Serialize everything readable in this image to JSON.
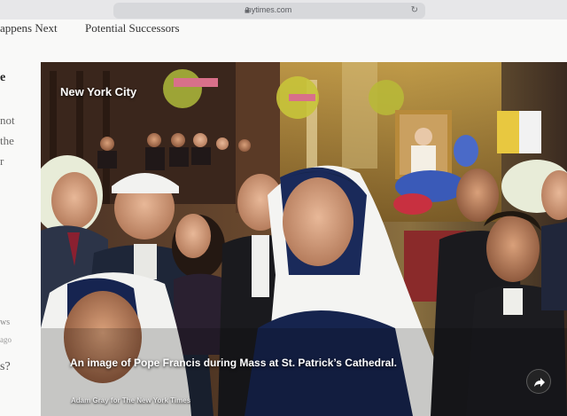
{
  "browser": {
    "url": "nytimes.com",
    "lock_icon": "lock-icon",
    "reload_icon": "reload-icon"
  },
  "topnav": {
    "items": [
      "appens Next",
      "Potential Successors"
    ]
  },
  "sidebar": {
    "fragments": [
      "e",
      "not",
      "the",
      "r",
      "ws",
      "ago",
      "s?"
    ]
  },
  "hero": {
    "location": "New York City",
    "caption": "An image of Pope Francis during Mass at St. Patrick’s Cathedral.",
    "credit": "Adam Gray for The New York Times",
    "share_icon": "share-icon"
  },
  "colors": {
    "chrome": "#e7e7e9",
    "page": "#f9f9f8",
    "caption_text": "#ffffff"
  }
}
